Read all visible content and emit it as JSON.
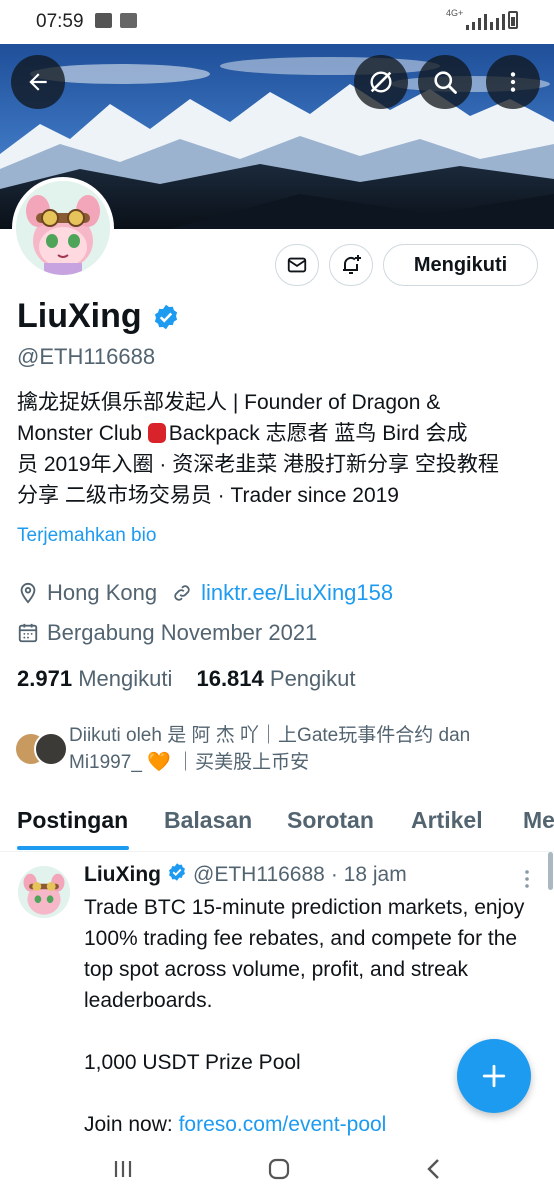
{
  "status_bar": {
    "time": "07:59",
    "network": "4G+"
  },
  "profile": {
    "name": "LiuXing",
    "handle": "@ETH116688",
    "follow_button": "Mengikuti",
    "bio_lines": [
      "擒龙捉妖俱乐部发起人 | Founder of Dragon &",
      "Monster Club ",
      "Backpack 志愿者  蓝鸟 Bird 会成",
      "员 2019年入圈 · 资深老韭菜 港股打新分享 空投教程",
      "分享 二级市场交易员 · Trader since 2019"
    ],
    "translate_bio": "Terjemahkan bio",
    "location": "Hong  Kong",
    "website": "linktr.ee/LiuXing158",
    "joined": "Bergabung November 2021",
    "following_count": "2.971",
    "following_label": "Mengikuti",
    "followers_count": "16.814",
    "followers_label": "Pengikut",
    "followed_by_line1": "Diikuti oleh 是 阿 杰 吖｜上Gate玩事件合约 dan",
    "followed_by_line2a": "Mi1997_",
    "followed_by_heart": "🧡",
    "followed_by_line2b": "｜买美股上币安"
  },
  "tabs": [
    {
      "label": "Postingan",
      "active": true
    },
    {
      "label": "Balasan"
    },
    {
      "label": "Sorotan"
    },
    {
      "label": "Artikel"
    },
    {
      "label": "Me"
    }
  ],
  "post": {
    "author": "LiuXing",
    "handle": "@ETH116688",
    "time": "· 18 jam",
    "body_p1": "Trade BTC 15-minute prediction markets, enjoy 100% trading fee rebates, and compete for the top spot across volume, profit, and streak leaderboards.",
    "body_p2": "1,000 USDT Prize Pool",
    "body_p3_prefix": "Join now: ",
    "body_p3_link": "foreso.com/event-pool"
  },
  "colors": {
    "accent": "#1d9bf0",
    "text": "#0f1419",
    "muted": "#536471"
  },
  "icons": [
    "back-arrow-icon",
    "grok-icon",
    "search-icon",
    "more-vertical-icon",
    "mail-icon",
    "bell-plus-icon",
    "verified-icon",
    "location-icon",
    "link-icon",
    "calendar-icon",
    "plus-icon"
  ]
}
